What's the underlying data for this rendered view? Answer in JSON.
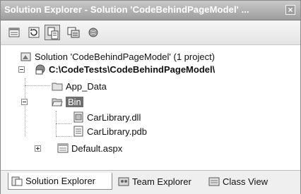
{
  "window": {
    "title": "Solution Explorer - Solution 'CodeBehindPageModel' ...",
    "close_glyph": "×"
  },
  "toolbar": {
    "buttons": [
      {
        "name": "properties-button",
        "icon": "properties-icon"
      },
      {
        "name": "refresh-button",
        "icon": "refresh-icon"
      },
      {
        "name": "show-all-files-button",
        "icon": "show-all-files-icon",
        "active": true
      },
      {
        "name": "view-code-button",
        "icon": "view-code-icon"
      },
      {
        "name": "nested-related-files-button",
        "icon": "copy-website-icon"
      }
    ]
  },
  "tree": {
    "solution": "Solution 'CodeBehindPageModel' (1 project)",
    "project": "C:\\CodeTests\\CodeBehindPageModel\\",
    "app_data": "App_Data",
    "bin": "Bin",
    "carlibrary_dll": "CarLibrary.dll",
    "carlibrary_pdb": "CarLibrary.pdb",
    "default_aspx": "Default.aspx"
  },
  "tabs": {
    "solution_explorer": "Solution Explorer",
    "team_explorer": "Team Explorer",
    "class_view": "Class View"
  }
}
